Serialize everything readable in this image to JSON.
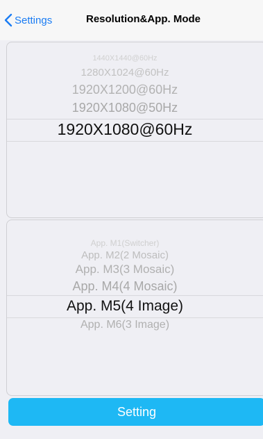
{
  "navbar": {
    "back_label": "Settings",
    "title": "Resolution&App. Mode"
  },
  "resolution_picker": {
    "items": [
      "1440X1440@60Hz",
      "1280X1024@60Hz",
      "1920X1200@60Hz",
      "1920X1080@50Hz",
      "1920X1080@60Hz"
    ],
    "selected": "1920X1080@60Hz"
  },
  "mode_picker": {
    "items": [
      "App. M1(Switcher)",
      "App. M2(2 Mosaic)",
      "App. M3(3 Mosaic)",
      "App. M4(4 Mosaic)",
      "App. M5(4 Image)",
      "App. M6(3 Image)"
    ],
    "selected": "App. M5(4 Image)"
  },
  "setting_button": {
    "label": "Setting"
  },
  "colors": {
    "accent": "#1a7cf3",
    "button_bg": "#1eb8f4",
    "background": "#efeff4"
  }
}
